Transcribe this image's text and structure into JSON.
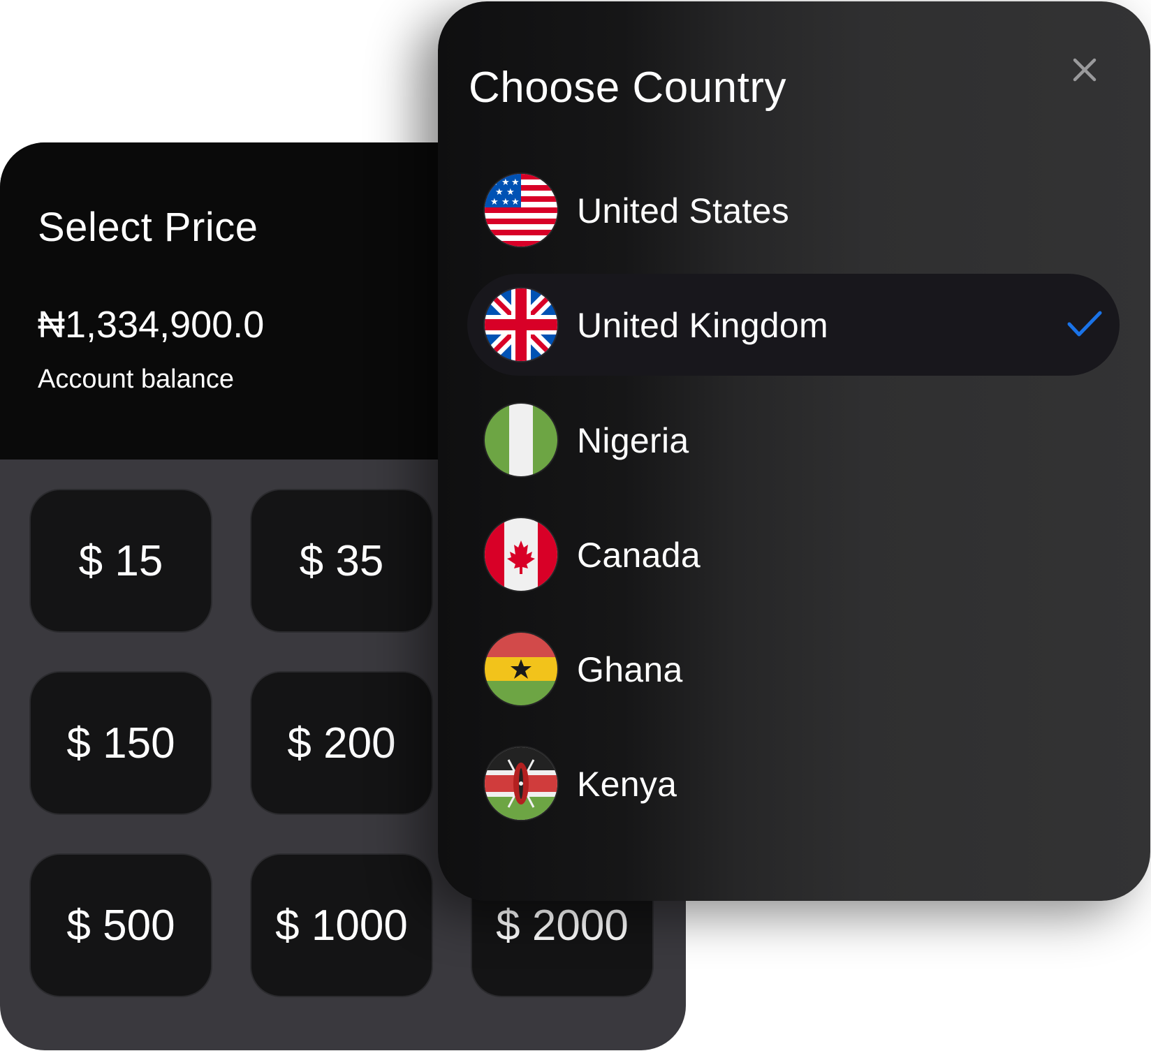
{
  "price_card": {
    "title": "Select Price",
    "balance_amount": "₦1,334,900.0",
    "balance_label": "Account balance",
    "prices": [
      "$ 15",
      "$ 35",
      "$ 150",
      "$ 200",
      "$ 500",
      "$ 1000",
      "$ 2000"
    ]
  },
  "country_panel": {
    "title": "Choose Country",
    "close_icon": "close-icon",
    "selected_country": "United Kingdom",
    "countries": [
      {
        "name": "United States",
        "flag": "us-flag-icon"
      },
      {
        "name": "United Kingdom",
        "flag": "uk-flag-icon"
      },
      {
        "name": "Nigeria",
        "flag": "nigeria-flag-icon"
      },
      {
        "name": "Canada",
        "flag": "canada-flag-icon"
      },
      {
        "name": "Ghana",
        "flag": "ghana-flag-icon"
      },
      {
        "name": "Kenya",
        "flag": "kenya-flag-icon"
      }
    ]
  },
  "colors": {
    "page_background": "#ffffff",
    "header_background": "#0a0a0a",
    "card_background": "#3a393e",
    "button_background": "#141415",
    "panel_background": "#333334",
    "selected_row": "#18171c",
    "check_accent": "#1a73e8",
    "text": "#ffffff"
  }
}
